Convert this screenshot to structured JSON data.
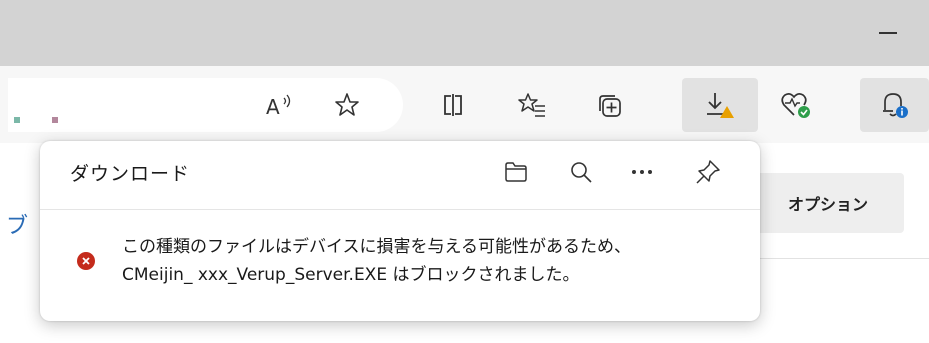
{
  "window": {
    "minimize_icon": "minimize-icon"
  },
  "address_bar": {
    "dot_colors": [
      "#7bb8a8",
      "#b3879c"
    ]
  },
  "toolbar": {
    "read_aloud_icon": "read-aloud-icon",
    "favorite_icon": "star-icon",
    "split_screen_icon": "split-screen-icon",
    "favorites_icon": "favorites-list-icon",
    "collections_icon": "collections-icon",
    "downloads_icon": "download-warning-icon",
    "browser_essentials_icon": "heart-health-icon",
    "notifications_icon": "bell-icon"
  },
  "background": {
    "options_label": "オプション",
    "partial_link": "ブ"
  },
  "downloads_panel": {
    "title": "ダウンロード",
    "folder_icon": "folder-icon",
    "search_icon": "search-icon",
    "more_icon": "more-icon",
    "pin_icon": "pin-icon",
    "item": {
      "status_icon": "error-icon",
      "status_color": "#c42b1c",
      "message_line1": "この種類のファイルはデバイスに損害を与える可能性があるため、",
      "message_line2": "CMeijin_ xxx_Verup_Server.EXE はブロックされました。"
    }
  }
}
